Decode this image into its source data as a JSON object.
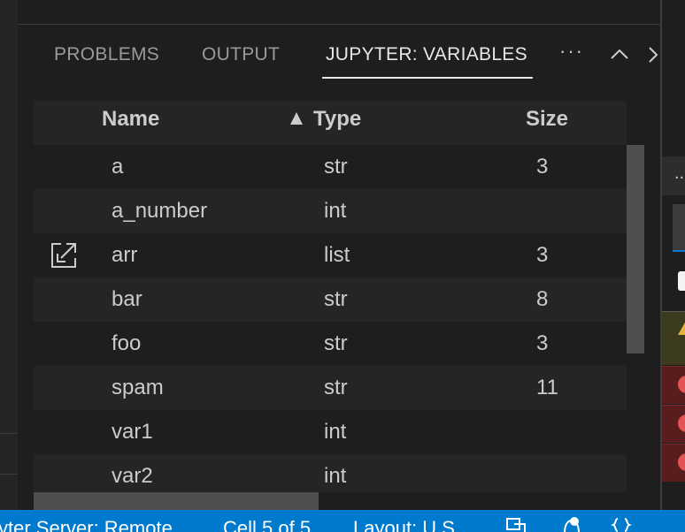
{
  "panel": {
    "tabs": [
      {
        "label": "PROBLEMS",
        "active": false
      },
      {
        "label": "OUTPUT",
        "active": false
      },
      {
        "label": "JUPYTER: VARIABLES",
        "active": true
      }
    ],
    "more_label": "···",
    "icons": [
      "collapse-panel-icon",
      "chevron-right-icon"
    ]
  },
  "variables": {
    "columns": {
      "name": "Name",
      "type": "Type",
      "size": "Size"
    },
    "sorted_by": "Type",
    "sort_direction": "ascending",
    "rows": [
      {
        "name": "a",
        "type": "str",
        "size": "3",
        "show_open_icon": false
      },
      {
        "name": "a_number",
        "type": "int",
        "size": "",
        "show_open_icon": false
      },
      {
        "name": "arr",
        "type": "list",
        "size": "3",
        "show_open_icon": true
      },
      {
        "name": "bar",
        "type": "str",
        "size": "8",
        "show_open_icon": false
      },
      {
        "name": "foo",
        "type": "str",
        "size": "3",
        "show_open_icon": false
      },
      {
        "name": "spam",
        "type": "str",
        "size": "11",
        "show_open_icon": false
      },
      {
        "name": "var1",
        "type": "int",
        "size": "",
        "show_open_icon": false
      },
      {
        "name": "var2",
        "type": "int",
        "size": "",
        "show_open_icon": false
      }
    ]
  },
  "right_pane": {
    "tab_label": "..."
  },
  "status_bar": {
    "server": "yter Server: Remote",
    "cell": "Cell 5 of 5",
    "layout": "Layout: U.S.",
    "icons": [
      "remote-explorer-icon",
      "notification-bell-icon",
      "braces-icon"
    ]
  },
  "colors": {
    "status_bar": "#007acc",
    "accent": "#0e7bd6",
    "warning": "#e5b53b",
    "error": "#e55454"
  }
}
